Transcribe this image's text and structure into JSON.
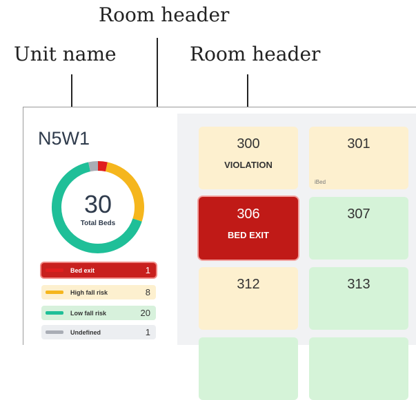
{
  "callouts": {
    "room_header_top": "Room header",
    "unit_name": "Unit name",
    "room_header": "Room header"
  },
  "unit": {
    "name": "N5W1",
    "total": "30",
    "total_label": "Total Beds"
  },
  "legend": [
    {
      "label": "Bed exit",
      "count": "1",
      "color": "#e01e1e",
      "bg": "#c8201e",
      "text": "#ffffff"
    },
    {
      "label": "High fall risk",
      "count": "8",
      "color": "#f5b61d",
      "bg": "#fdf0cf",
      "text": "#333333"
    },
    {
      "label": "Low fall risk",
      "count": "20",
      "color": "#1fbf98",
      "bg": "#d7f1dc",
      "text": "#333333"
    },
    {
      "label": "Undefined",
      "count": "1",
      "color": "#a9adb5",
      "bg": "#eceef1",
      "text": "#333333"
    }
  ],
  "donut_segments": [
    {
      "name": "bed-exit",
      "value": 1,
      "color": "#e01e1e"
    },
    {
      "name": "high-fall-risk",
      "value": 8,
      "color": "#f5b61d"
    },
    {
      "name": "low-fall-risk",
      "value": 20,
      "color": "#1fbf98"
    },
    {
      "name": "undefined",
      "value": 1,
      "color": "#a9adb5"
    }
  ],
  "rooms": [
    {
      "number": "300",
      "status": "VIOLATION",
      "tag": "",
      "state": "high-fall-risk"
    },
    {
      "number": "301",
      "status": "",
      "tag": "iBed",
      "state": "high-fall-risk"
    },
    {
      "number": "306",
      "status": "BED EXIT",
      "tag": "",
      "state": "bed-exit"
    },
    {
      "number": "307",
      "status": "",
      "tag": "",
      "state": "low-fall-risk"
    },
    {
      "number": "312",
      "status": "",
      "tag": "",
      "state": "high-fall-risk"
    },
    {
      "number": "313",
      "status": "",
      "tag": "",
      "state": "low-fall-risk"
    },
    {
      "number": "",
      "status": "",
      "tag": "",
      "state": "low-fall-risk"
    },
    {
      "number": "",
      "status": "",
      "tag": "",
      "state": "low-fall-risk"
    }
  ],
  "room_colors": {
    "high-fall-risk": "#fdf0cf",
    "low-fall-risk": "#d5f3d8",
    "bed-exit": "#c01a17"
  }
}
